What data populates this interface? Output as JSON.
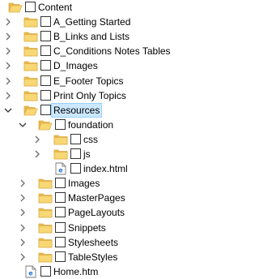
{
  "tree": {
    "items": [
      {
        "label": "Content",
        "kind": "folder",
        "state": "expanded-root",
        "level": 0
      },
      {
        "label": "A_Getting Started",
        "kind": "folder",
        "state": "collapsed",
        "level": 1
      },
      {
        "label": "B_Links and Lists",
        "kind": "folder",
        "state": "collapsed",
        "level": 1
      },
      {
        "label": "C_Conditions Notes Tables",
        "kind": "folder",
        "state": "collapsed",
        "level": 1
      },
      {
        "label": "D_Images",
        "kind": "folder",
        "state": "collapsed",
        "level": 1
      },
      {
        "label": "E_Footer Topics",
        "kind": "folder",
        "state": "collapsed",
        "level": 1
      },
      {
        "label": "Print Only Topics",
        "kind": "folder",
        "state": "collapsed",
        "level": 1
      },
      {
        "label": "Resources",
        "kind": "folder",
        "state": "expanded",
        "level": 1,
        "selected": true
      },
      {
        "label": "foundation",
        "kind": "folder",
        "state": "expanded",
        "level": 2
      },
      {
        "label": "css",
        "kind": "folder",
        "state": "collapsed",
        "level": 3
      },
      {
        "label": "js",
        "kind": "folder",
        "state": "collapsed",
        "level": 3
      },
      {
        "label": "index.html",
        "kind": "file",
        "state": "none",
        "level": 3
      },
      {
        "label": "Images",
        "kind": "folder",
        "state": "collapsed",
        "level": 2
      },
      {
        "label": "MasterPages",
        "kind": "folder",
        "state": "collapsed",
        "level": 2
      },
      {
        "label": "PageLayouts",
        "kind": "folder",
        "state": "collapsed",
        "level": 2
      },
      {
        "label": "Snippets",
        "kind": "folder",
        "state": "collapsed",
        "level": 2
      },
      {
        "label": "Stylesheets",
        "kind": "folder",
        "state": "collapsed",
        "level": 2
      },
      {
        "label": "TableStyles",
        "kind": "folder",
        "state": "collapsed",
        "level": 2
      },
      {
        "label": "Home.htm",
        "kind": "file",
        "state": "none",
        "level": 1
      }
    ]
  },
  "colors": {
    "folder_body": "#f8d775",
    "folder_edge": "#dcb047",
    "folder_tab": "#e8b84b",
    "selection_fill": "#cce8ff",
    "selection_border": "#99d1ff",
    "file_icon_accent": "#1f6fd1",
    "chevron": "#6b6b6b"
  }
}
